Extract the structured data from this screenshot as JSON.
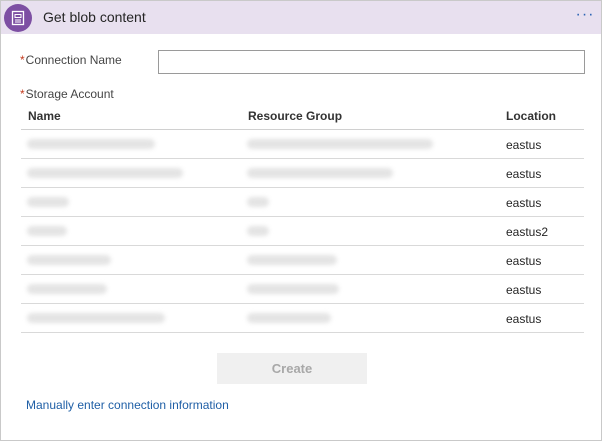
{
  "header": {
    "title": "Get blob content",
    "icon": "storage-blob-icon",
    "menu_glyph": "···",
    "accent_color": "#7d4fa3",
    "background_color": "#e8e0ef"
  },
  "form": {
    "required_marker": "*",
    "connection_name_label": "Connection Name",
    "connection_name_value": "",
    "storage_account_label": "Storage Account"
  },
  "table": {
    "columns": [
      "Name",
      "Resource Group",
      "Location"
    ],
    "rows": [
      {
        "location": "eastus"
      },
      {
        "location": "eastus"
      },
      {
        "location": "eastus"
      },
      {
        "location": "eastus2"
      },
      {
        "location": "eastus"
      },
      {
        "location": "eastus"
      },
      {
        "location": "eastus"
      }
    ]
  },
  "actions": {
    "create_label": "Create",
    "manual_link": "Manually enter connection information"
  }
}
